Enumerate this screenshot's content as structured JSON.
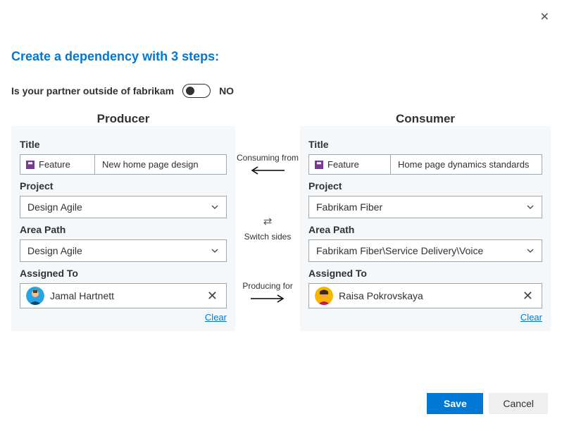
{
  "header": {
    "title": "Create a dependency with 3 steps:"
  },
  "partner": {
    "question_prefix": "Is your partner outside of ",
    "org": "fabrikam",
    "toggle_value": "NO"
  },
  "producer": {
    "heading": "Producer",
    "title_label": "Title",
    "type": "Feature",
    "title_value": "New home page design",
    "project_label": "Project",
    "project": "Design Agile",
    "area_label": "Area Path",
    "area": "Design Agile",
    "assigned_label": "Assigned To",
    "assigned": "Jamal Hartnett",
    "clear": "Clear"
  },
  "consumer": {
    "heading": "Consumer",
    "title_label": "Title",
    "type": "Feature",
    "title_value": "Home page dynamics standards",
    "project_label": "Project",
    "project": "Fabrikam Fiber",
    "area_label": "Area Path",
    "area": "Fabrikam Fiber\\Service Delivery\\Voice",
    "assigned_label": "Assigned To",
    "assigned": "Raisa Pokrovskaya",
    "clear": "Clear"
  },
  "middle": {
    "consuming": "Consuming from",
    "switch": "Switch sides",
    "producing": "Producing for"
  },
  "footer": {
    "save": "Save",
    "cancel": "Cancel"
  }
}
